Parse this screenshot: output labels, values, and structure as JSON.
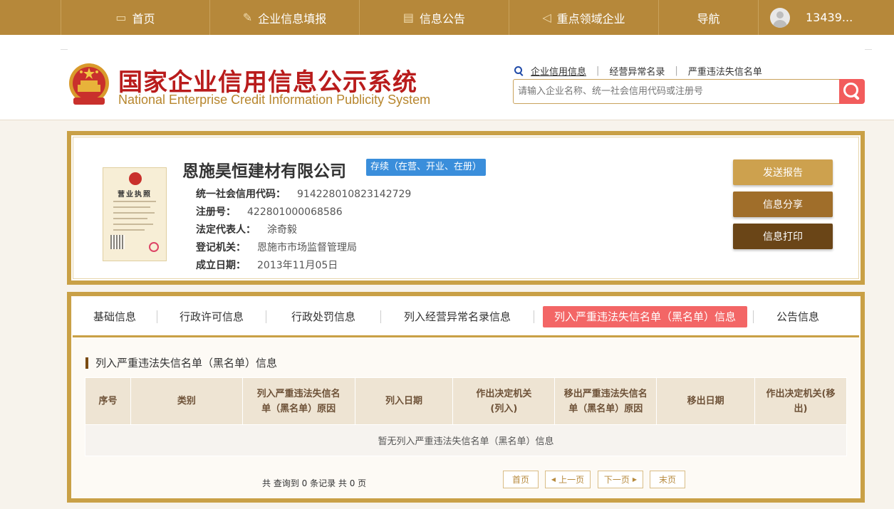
{
  "topnav": {
    "items": [
      {
        "label": "首页",
        "icon": "monitor-icon"
      },
      {
        "label": "企业信息填报",
        "icon": "pencil-icon"
      },
      {
        "label": "信息公告",
        "icon": "document-icon"
      },
      {
        "label": "重点领域企业",
        "icon": "megaphone-icon"
      },
      {
        "label": "导航",
        "icon": ""
      }
    ],
    "user": "13439..."
  },
  "header": {
    "title_cn": "国家企业信用信息公示系统",
    "title_en": "National Enterprise Credit Information Publicity System",
    "quicklinks": [
      "企业信用信息",
      "经营异常名录",
      "严重违法失信名单"
    ],
    "search_placeholder": "请输入企业名称、统一社会信用代码或注册号"
  },
  "company": {
    "name": "恩施昊恒建材有限公司",
    "status": "存续（在营、开业、在册）",
    "license_title": "营业执照",
    "fields": [
      {
        "label": "统一社会信用代码：",
        "value": "914228010823142729"
      },
      {
        "label": "注册号：",
        "value": "422801000068586"
      },
      {
        "label": "法定代表人：",
        "value": "涂奇毅"
      },
      {
        "label": "登记机关：",
        "value": "恩施市市场监督管理局"
      },
      {
        "label": "成立日期：",
        "value": "2013年11月05日"
      }
    ],
    "actions": [
      {
        "label": "发送报告",
        "color": "#cda14e"
      },
      {
        "label": "信息分享",
        "color": "#a06e2a"
      },
      {
        "label": "信息打印",
        "color": "#6a4517"
      }
    ]
  },
  "tabs": [
    {
      "label": "基础信息"
    },
    {
      "label": "行政许可信息"
    },
    {
      "label": "行政处罚信息"
    },
    {
      "label": "列入经营异常名录信息"
    },
    {
      "label": "列入严重违法失信名单（黑名单）信息",
      "active": true
    },
    {
      "label": "公告信息"
    }
  ],
  "section": {
    "title": "列入严重违法失信名单（黑名单）信息",
    "columns": [
      "序号",
      "类别",
      "列入严重违法失信名单（黑名单）原因",
      "列入日期",
      "作出决定机关(列入)",
      "移出严重违法失信名单（黑名单）原因",
      "移出日期",
      "作出决定机关(移出)"
    ],
    "empty_text": "暂无列入严重违法失信名单（黑名单）信息"
  },
  "pager": {
    "count_text": "共 查询到 0 条记录 共 0 页",
    "first": "首页",
    "prev": "上一页",
    "next": "下一页",
    "last": "末页"
  }
}
